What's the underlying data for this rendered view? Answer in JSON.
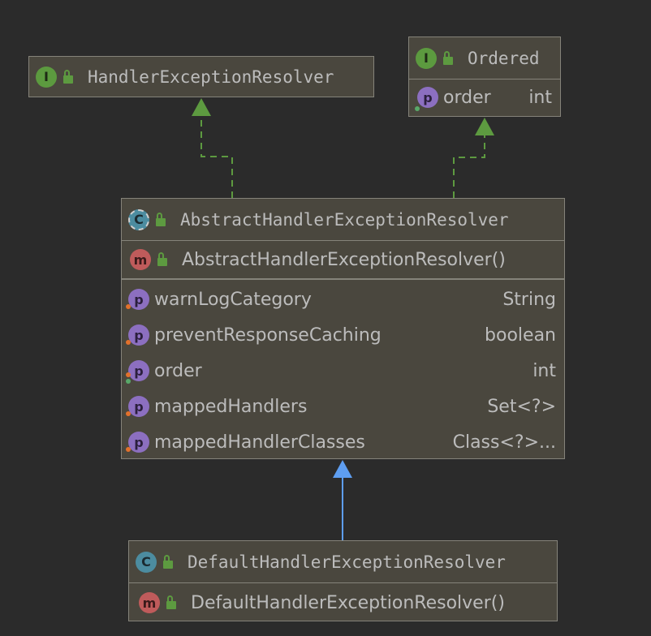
{
  "colors": {
    "background": "#2b2b2b",
    "box_fill": "#4a473e",
    "box_border": "#85837a",
    "realization_arrow": "#5d9a40",
    "generalization_arrow": "#5e9ef1"
  },
  "nodes": {
    "handler_exception_resolver": {
      "kind": "interface",
      "badge": "I",
      "visibility_icon": "unlocked-icon",
      "name": "HandlerExceptionResolver"
    },
    "ordered": {
      "kind": "interface",
      "badge": "I",
      "visibility_icon": "unlocked-icon",
      "name": "Ordered",
      "properties": [
        {
          "badge": "p",
          "name": "order",
          "type": "int"
        }
      ]
    },
    "abstract_resolver": {
      "kind": "abstract-class",
      "badge": "C",
      "visibility_icon": "unlocked-icon",
      "name": "AbstractHandlerExceptionResolver",
      "constructor": {
        "badge": "m",
        "name": "AbstractHandlerExceptionResolver()"
      },
      "properties": [
        {
          "badge": "p",
          "name": "warnLogCategory",
          "type": "String"
        },
        {
          "badge": "p",
          "name": "preventResponseCaching",
          "type": "boolean"
        },
        {
          "badge": "p",
          "name": "order",
          "type": "int"
        },
        {
          "badge": "p",
          "name": "mappedHandlers",
          "type": "Set<?>"
        },
        {
          "badge": "p",
          "name": "mappedHandlerClasses",
          "type": "Class<?>..."
        }
      ]
    },
    "default_resolver": {
      "kind": "class",
      "badge": "C",
      "visibility_icon": "unlocked-icon",
      "name": "DefaultHandlerExceptionResolver",
      "constructor": {
        "badge": "m",
        "name": "DefaultHandlerExceptionResolver()"
      }
    }
  },
  "edges": [
    {
      "from": "abstract_resolver",
      "to": "handler_exception_resolver",
      "kind": "realization"
    },
    {
      "from": "abstract_resolver",
      "to": "ordered",
      "kind": "realization"
    },
    {
      "from": "default_resolver",
      "to": "abstract_resolver",
      "kind": "generalization"
    }
  ]
}
